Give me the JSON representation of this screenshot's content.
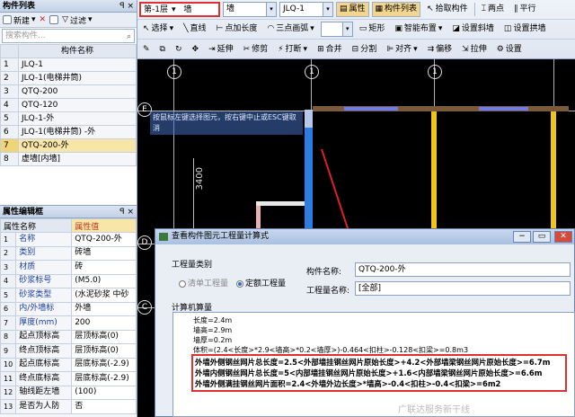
{
  "component_list": {
    "title": "构件列表",
    "pin": "ꟼ ×",
    "toolbar": {
      "new_label": "新建",
      "filter_label": "过滤"
    },
    "search_placeholder": "搜索构件...",
    "column_header": "构件名称",
    "rows": [
      {
        "num": "1",
        "name": "JLQ-1"
      },
      {
        "num": "2",
        "name": "JLQ-1(电梯井筒)"
      },
      {
        "num": "3",
        "name": "QTQ-200"
      },
      {
        "num": "4",
        "name": "QTQ-120"
      },
      {
        "num": "5",
        "name": "JLQ-1-外"
      },
      {
        "num": "6",
        "name": "JLQ-1(电梯井筒) -外"
      },
      {
        "num": "7",
        "name": "QTQ-200-外"
      },
      {
        "num": "8",
        "name": "虚墙[内墙]"
      }
    ],
    "selected_index": 6
  },
  "property_editor": {
    "title": "属性编辑框",
    "pin": "ꟼ ×",
    "header_name": "属性名称",
    "header_value": "属性值",
    "rows": [
      {
        "num": "1",
        "key": "名称",
        "value": "QTQ-200-外"
      },
      {
        "num": "2",
        "key": "类别",
        "value": "砖墙"
      },
      {
        "num": "3",
        "key": "材质",
        "value": "砖"
      },
      {
        "num": "4",
        "key": "砂浆标号",
        "value": "(M5.0)"
      },
      {
        "num": "5",
        "key": "砂浆类型",
        "value": "(水泥砂浆 中砂"
      },
      {
        "num": "6",
        "key": "内/外墙标",
        "value": "外墙"
      },
      {
        "num": "7",
        "key": "厚度(mm)",
        "value": "200"
      },
      {
        "num": "8",
        "key": "起点顶标高",
        "value": "层顶标高(0)"
      },
      {
        "num": "9",
        "key": "终点顶标高",
        "value": "层顶标高(0)"
      },
      {
        "num": "10",
        "key": "起点底标高",
        "value": "层底标高(-2.9)"
      },
      {
        "num": "11",
        "key": "终点底标高",
        "value": "层底标高(-2.9)"
      },
      {
        "num": "12",
        "key": "轴线距左墙",
        "value": "(100)"
      },
      {
        "num": "13",
        "key": "是否为人防",
        "value": "否"
      }
    ]
  },
  "toolbar": {
    "floor_value": "第-1层",
    "type_value": "墙",
    "type2_value": "墙",
    "component_value": "JLQ-1",
    "btn_property": "属性",
    "btn_list": "构件列表",
    "btn_pick": "拾取构件",
    "btn_two_point": "两点",
    "btn_parallel": "平行",
    "btn_select": "选择",
    "btn_line": "直线",
    "btn_point_length": "点加长度",
    "btn_three_arc": "三点画弧",
    "btn_rect": "矩形",
    "btn_smart": "智能布置",
    "btn_set_slope": "设置斜墙",
    "btn_set_arch": "设置拱墙",
    "btn_extend": "延伸",
    "btn_trim": "修剪",
    "btn_break": "打断",
    "btn_merge": "合并",
    "btn_split": "分割",
    "btn_align": "对齐",
    "btn_offset": "偏移",
    "btn_stretch": "拉伸",
    "btn_set": "设置"
  },
  "canvas": {
    "axis_labels": [
      "1",
      "1",
      "1"
    ],
    "row_labels": [
      "E",
      "D",
      "C"
    ],
    "dimension": "3400",
    "hint": "按鼠标左键选择图元，按右键中止或ESC键取消",
    "colors": {
      "column": "#2a7de1",
      "beam_yellow": "#f0c419",
      "beam_blue": "#6c7cf0",
      "wall_brown": "#7a5a3a",
      "arrow": "#e02020"
    }
  },
  "dialog": {
    "title": "查看构件图元工程量计算式",
    "category_label": "工程量类别",
    "option_list": "清单工程量",
    "option_quota": "定额工程量",
    "component_name_label": "构件名称:",
    "component_name_value": "QTQ-200-外",
    "quantity_name_label": "工程量名称:",
    "quantity_name_value": "[全部]",
    "calc_label": "计算机算量",
    "lines": [
      "长度=2.4m",
      "墙高=2.9m",
      "墙厚=0.2m",
      "体积=(2.4<长度>*2.9<墙高>*0.2<墙厚>)-0.464<扣柱>-0.128<扣梁>=0.8m3",
      "外墙外侧钢丝网片总长度=2.5<外部墙挂钢丝网片原始长度>+4.2<外部墙梁钢丝网片原始长度>=6.7m",
      "外墙内侧钢丝网片总长度=5<内部墙挂钢丝网片原始长度>+1.6<内部墙梁钢丝网片原始长度>=6.6m",
      "外墙外侧满挂钢丝网片面积=2.4<外墙外边长度>*墙高>-0.4<扣柱>-0.4<扣梁>=6m2"
    ],
    "watermark": "广联达服务新干线"
  }
}
